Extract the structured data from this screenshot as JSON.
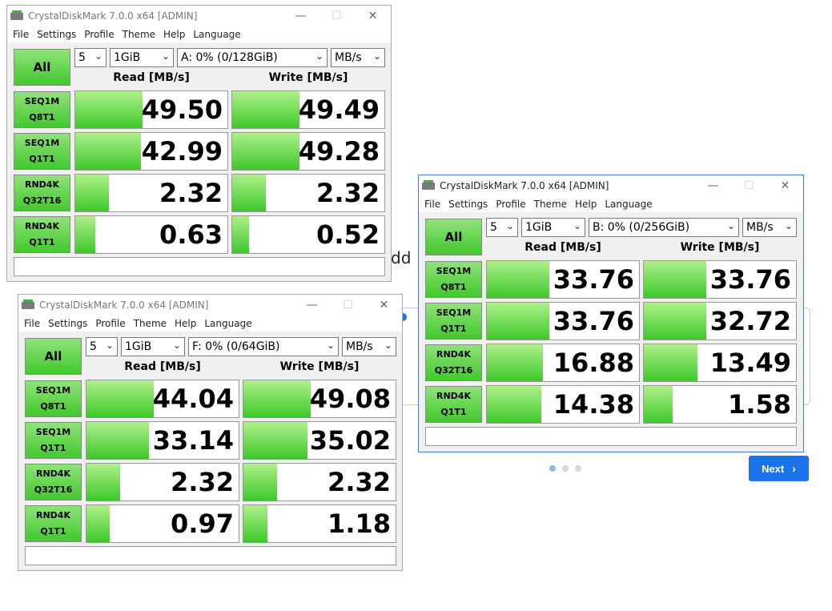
{
  "background": {
    "partial_word": "dd",
    "next_label": "Next",
    "pager_dots": 3,
    "pager_active": 0
  },
  "windows": [
    {
      "title": "CrystalDiskMark 7.0.0 x64 [ADMIN]",
      "menu": [
        "File",
        "Settings",
        "Profile",
        "Theme",
        "Help",
        "Language"
      ],
      "all_label": "All",
      "count": "5",
      "size": "1GiB",
      "drive": "A: 0% (0/128GiB)",
      "unit": "MB/s",
      "read_header": "Read [MB/s]",
      "write_header": "Write [MB/s]",
      "rows": [
        {
          "test": "SEQ1M",
          "param": "Q8T1",
          "read": "49.50",
          "write": "49.49",
          "read_fill": 0.44,
          "write_fill": 0.44
        },
        {
          "test": "SEQ1M",
          "param": "Q1T1",
          "read": "42.99",
          "write": "49.28",
          "read_fill": 0.43,
          "write_fill": 0.44
        },
        {
          "test": "RND4K",
          "param": "Q32T16",
          "read": "2.32",
          "write": "2.32",
          "read_fill": 0.22,
          "write_fill": 0.22
        },
        {
          "test": "RND4K",
          "param": "Q1T1",
          "read": "0.63",
          "write": "0.52",
          "read_fill": 0.13,
          "write_fill": 0.11
        }
      ]
    },
    {
      "title": "CrystalDiskMark 7.0.0 x64 [ADMIN]",
      "menu": [
        "File",
        "Settings",
        "Profile",
        "Theme",
        "Help",
        "Language"
      ],
      "all_label": "All",
      "count": "5",
      "size": "1GiB",
      "drive": "F: 0% (0/64GiB)",
      "unit": "MB/s",
      "read_header": "Read [MB/s]",
      "write_header": "Write [MB/s]",
      "rows": [
        {
          "test": "SEQ1M",
          "param": "Q8T1",
          "read": "44.04",
          "write": "49.08",
          "read_fill": 0.44,
          "write_fill": 0.44
        },
        {
          "test": "SEQ1M",
          "param": "Q1T1",
          "read": "33.14",
          "write": "35.02",
          "read_fill": 0.41,
          "write_fill": 0.42
        },
        {
          "test": "RND4K",
          "param": "Q32T16",
          "read": "2.32",
          "write": "2.32",
          "read_fill": 0.22,
          "write_fill": 0.22
        },
        {
          "test": "RND4K",
          "param": "Q1T1",
          "read": "0.97",
          "write": "1.18",
          "read_fill": 0.15,
          "write_fill": 0.16
        }
      ]
    },
    {
      "title": "CrystalDiskMark 7.0.0 x64 [ADMIN]",
      "menu": [
        "File",
        "Settings",
        "Profile",
        "Theme",
        "Help",
        "Language"
      ],
      "all_label": "All",
      "count": "5",
      "size": "1GiB",
      "drive": "B: 0% (0/256GiB)",
      "unit": "MB/s",
      "read_header": "Read [MB/s]",
      "write_header": "Write [MB/s]",
      "rows": [
        {
          "test": "SEQ1M",
          "param": "Q8T1",
          "read": "33.76",
          "write": "33.76",
          "read_fill": 0.41,
          "write_fill": 0.41
        },
        {
          "test": "SEQ1M",
          "param": "Q1T1",
          "read": "33.76",
          "write": "32.72",
          "read_fill": 0.41,
          "write_fill": 0.41
        },
        {
          "test": "RND4K",
          "param": "Q32T16",
          "read": "16.88",
          "write": "13.49",
          "read_fill": 0.37,
          "write_fill": 0.35
        },
        {
          "test": "RND4K",
          "param": "Q1T1",
          "read": "14.38",
          "write": "1.58",
          "read_fill": 0.36,
          "write_fill": 0.19
        }
      ]
    }
  ]
}
